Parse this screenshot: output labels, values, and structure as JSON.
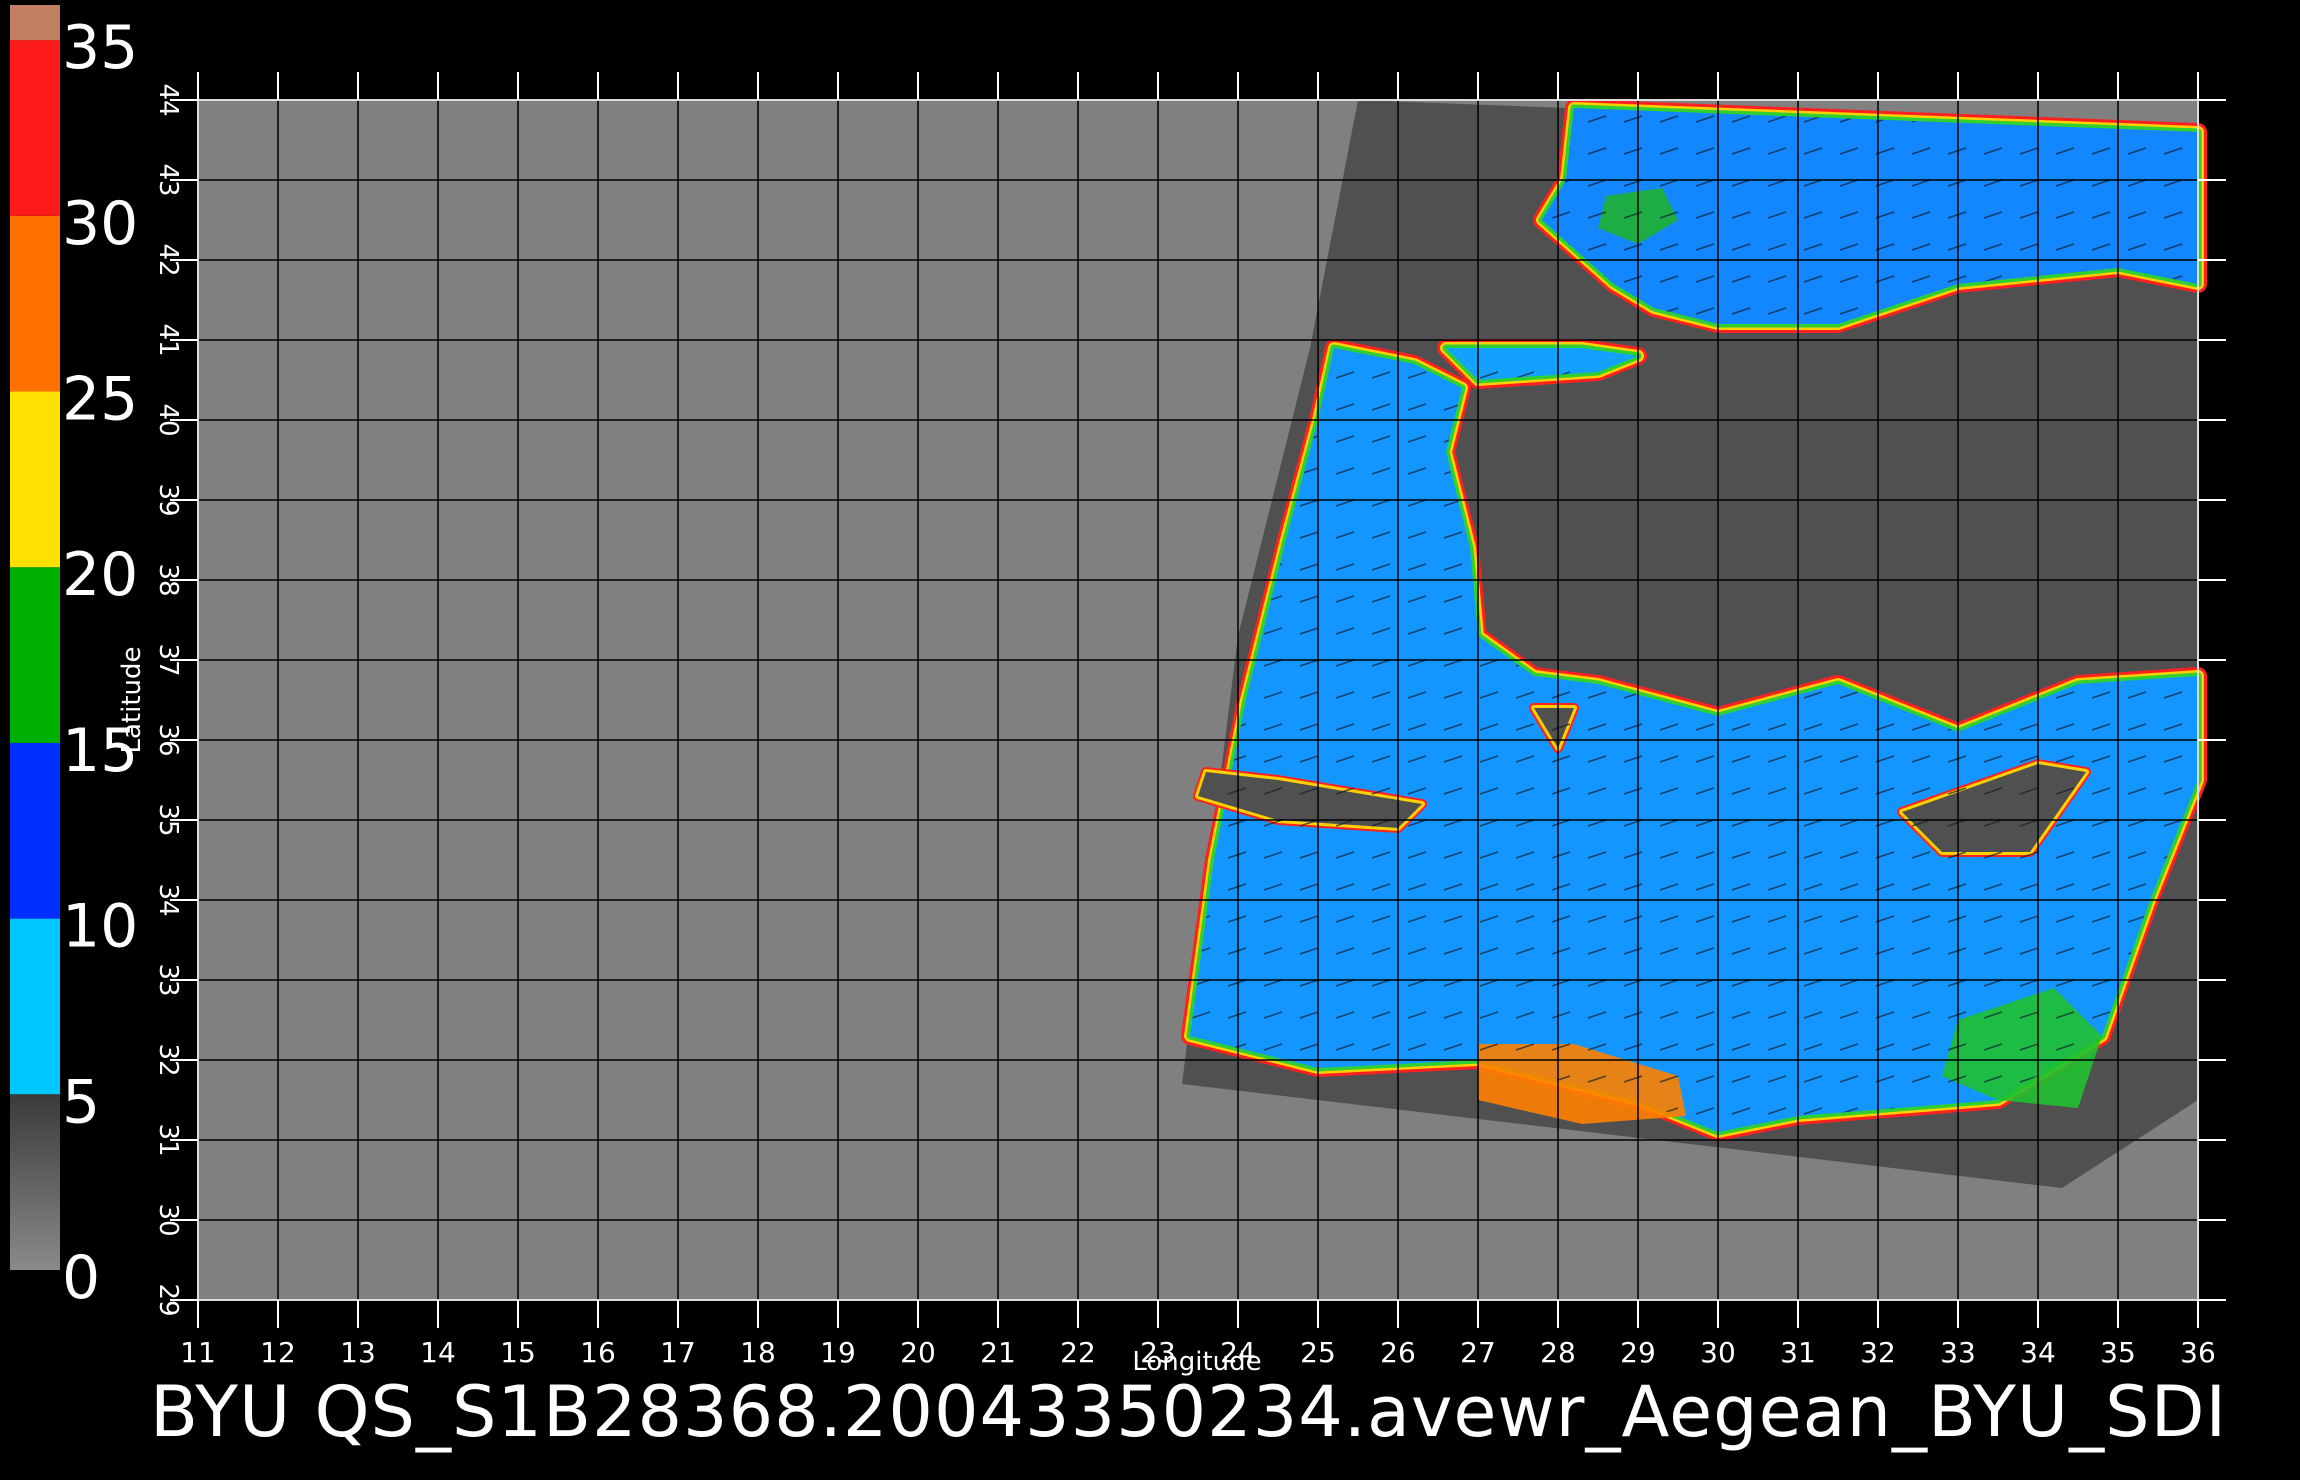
{
  "colorbar": {
    "labels": [
      "35",
      "30",
      "25",
      "20",
      "15",
      "10",
      "5",
      "0"
    ],
    "values": [
      35,
      30,
      25,
      20,
      15,
      10,
      5,
      0
    ],
    "stops": [
      {
        "from": 0,
        "to": 5,
        "color": "#5a5a5a"
      },
      {
        "from": 5,
        "to": 10,
        "color": "#00c8ff"
      },
      {
        "from": 10,
        "to": 15,
        "color": "#0030ff"
      },
      {
        "from": 15,
        "to": 20,
        "color": "#00b000"
      },
      {
        "from": 20,
        "to": 25,
        "color": "#ffe000"
      },
      {
        "from": 25,
        "to": 30,
        "color": "#ff7000"
      },
      {
        "from": 30,
        "to": 35,
        "color": "#ff1a1a"
      },
      {
        "from": 35,
        "to": 36,
        "color": "#c08060"
      }
    ]
  },
  "map": {
    "lon_range": [
      11,
      36
    ],
    "lat_range": [
      29,
      44
    ],
    "x_ticks": [
      "11",
      "12",
      "13",
      "14",
      "15",
      "16",
      "17",
      "18",
      "19",
      "20",
      "21",
      "22",
      "23",
      "24",
      "25",
      "26",
      "27",
      "28",
      "29",
      "30",
      "31",
      "32",
      "33",
      "34",
      "35",
      "36"
    ],
    "y_ticks": [
      "29",
      "30",
      "31",
      "32",
      "33",
      "34",
      "35",
      "36",
      "37",
      "38",
      "39",
      "40",
      "41",
      "42",
      "43",
      "44"
    ],
    "xlabel": "Longitude",
    "ylabel": "Latitude",
    "background_color": "#808080",
    "swath_color": "#505050",
    "swath_corners": [
      [
        25.5,
        44.0
      ],
      [
        36.0,
        43.6
      ],
      [
        36.0,
        31.5
      ],
      [
        34.3,
        30.4
      ],
      [
        23.3,
        31.7
      ],
      [
        24.0,
        37.3
      ],
      [
        24.9,
        40.9
      ]
    ],
    "regions": [
      {
        "name": "black-sea",
        "color": "#1e64ff",
        "outline": [
          [
            28.2,
            43.9
          ],
          [
            36.0,
            43.6
          ],
          [
            36.0,
            41.7
          ],
          [
            35.0,
            41.9
          ],
          [
            33.0,
            41.7
          ],
          [
            31.5,
            41.2
          ],
          [
            30.0,
            41.2
          ],
          [
            29.2,
            41.4
          ],
          [
            28.7,
            41.7
          ],
          [
            27.8,
            42.5
          ],
          [
            28.1,
            43.0
          ]
        ]
      },
      {
        "name": "aegean-sea",
        "color": "#1e7cff",
        "outline": [
          [
            25.2,
            40.9
          ],
          [
            26.2,
            40.7
          ],
          [
            26.8,
            40.4
          ],
          [
            26.6,
            39.6
          ],
          [
            26.9,
            38.4
          ],
          [
            27.0,
            37.3
          ],
          [
            27.7,
            36.8
          ],
          [
            28.5,
            36.7
          ],
          [
            30.0,
            36.3
          ],
          [
            31.5,
            36.7
          ],
          [
            33.0,
            36.1
          ],
          [
            34.5,
            36.7
          ],
          [
            36.0,
            36.8
          ],
          [
            36.0,
            35.5
          ],
          [
            35.4,
            34.0
          ],
          [
            34.8,
            32.3
          ],
          [
            33.5,
            31.5
          ],
          [
            31.0,
            31.3
          ],
          [
            30.0,
            31.1
          ],
          [
            29.0,
            31.5
          ],
          [
            27.0,
            32.0
          ],
          [
            25.0,
            31.9
          ],
          [
            23.4,
            32.3
          ],
          [
            23.7,
            34.5
          ],
          [
            24.1,
            36.5
          ],
          [
            24.6,
            38.5
          ],
          [
            25.0,
            40.0
          ]
        ]
      },
      {
        "name": "marmara-sea",
        "color": "#1e8cff",
        "outline": [
          [
            26.6,
            40.9
          ],
          [
            27.3,
            40.9
          ],
          [
            28.3,
            40.9
          ],
          [
            29.0,
            40.8
          ],
          [
            28.5,
            40.6
          ],
          [
            27.0,
            40.5
          ]
        ]
      }
    ],
    "land_patches": [
      {
        "name": "crete",
        "outline": [
          [
            23.6,
            35.6
          ],
          [
            24.5,
            35.5
          ],
          [
            26.3,
            35.2
          ],
          [
            26.0,
            34.9
          ],
          [
            24.5,
            35.0
          ],
          [
            23.5,
            35.3
          ]
        ]
      },
      {
        "name": "cyprus",
        "outline": [
          [
            32.3,
            35.1
          ],
          [
            34.0,
            35.7
          ],
          [
            34.6,
            35.6
          ],
          [
            33.9,
            34.6
          ],
          [
            32.8,
            34.6
          ]
        ]
      },
      {
        "name": "rhodes",
        "outline": [
          [
            27.7,
            36.4
          ],
          [
            28.2,
            36.4
          ],
          [
            28.0,
            35.9
          ]
        ]
      }
    ],
    "hotspots": [
      {
        "name": "libya-coast-high-wind",
        "color": "#ff8000",
        "outline": [
          [
            27.0,
            32.2
          ],
          [
            28.2,
            32.2
          ],
          [
            29.5,
            31.8
          ],
          [
            29.6,
            31.3
          ],
          [
            28.3,
            31.2
          ],
          [
            27.0,
            31.5
          ]
        ]
      },
      {
        "name": "levant-coast-green",
        "color": "#20c030",
        "outline": [
          [
            33.0,
            32.5
          ],
          [
            34.2,
            32.9
          ],
          [
            34.8,
            32.3
          ],
          [
            34.5,
            31.4
          ],
          [
            33.5,
            31.5
          ],
          [
            32.8,
            31.8
          ]
        ]
      },
      {
        "name": "black-sea-green",
        "color": "#20b030",
        "outline": [
          [
            28.6,
            42.8
          ],
          [
            29.3,
            42.9
          ],
          [
            29.5,
            42.5
          ],
          [
            29.0,
            42.2
          ],
          [
            28.5,
            42.4
          ]
        ]
      }
    ]
  },
  "caption": "BYU  QS_S1B28368.20043350234.avewr_Aegean_BYU_SDI"
}
